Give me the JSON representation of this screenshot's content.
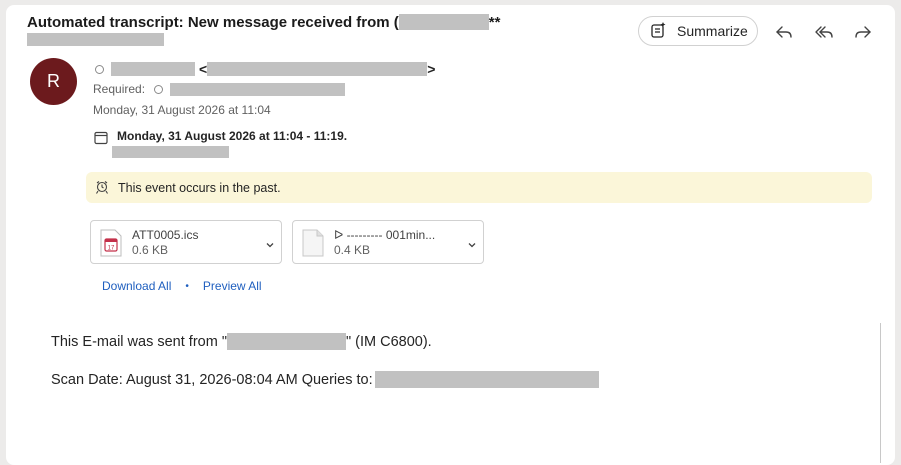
{
  "email": {
    "subject_prefix": "Automated transcript: New message received from (",
    "subject_suffix": "**",
    "date_sent": "Monday, 31 August 2026 at 11:04",
    "sender_lt": "<",
    "sender_gt": ">",
    "avatar_initial": "R",
    "required_label": "Required:"
  },
  "toolbar": {
    "summarize_label": "Summarize"
  },
  "event": {
    "time_range": "Monday, 31 August 2026 at 11:04 - 11:19.",
    "banner_text": "This event occurs in the past."
  },
  "attachments": [
    {
      "name": "ATT0005.ics",
      "size": "0.6 KB",
      "icon": "calendar-file-icon",
      "cal_day": "17"
    },
    {
      "name": "ᐅ --------- 001min...",
      "size": "0.4 KB",
      "icon": "generic-file-icon"
    }
  ],
  "attachment_actions": {
    "download_all": "Download All",
    "separator": "•",
    "preview_all": "Preview All"
  },
  "body": {
    "line1_prefix": "This E-mail was sent from \"",
    "line1_suffix": "\" (IM C6800).",
    "line2": "Scan Date: August 31, 2026-08:04 AM Queries to:"
  }
}
